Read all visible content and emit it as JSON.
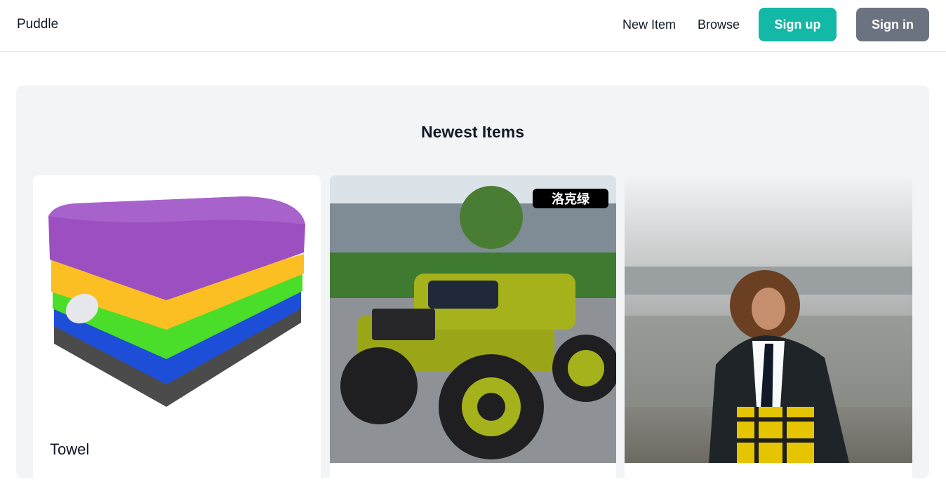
{
  "header": {
    "brand": "Puddle",
    "nav": {
      "new_item": "New Item",
      "browse": "Browse"
    },
    "buttons": {
      "sign_up": "Sign up",
      "sign_in": "Sign in"
    }
  },
  "main": {
    "section_title": "Newest Items",
    "items": [
      {
        "title": "Towel",
        "image": "stacked-microfiber-towels"
      },
      {
        "title": "",
        "image": "green-ride-on-toy-jeep",
        "badge": "洛克绿"
      },
      {
        "title": "",
        "image": "fashion-model-jacket-plaid-skirt"
      }
    ]
  },
  "colors": {
    "sign_up": "#14b8a6",
    "sign_in": "#6b7280",
    "section_bg": "#f3f4f6"
  }
}
